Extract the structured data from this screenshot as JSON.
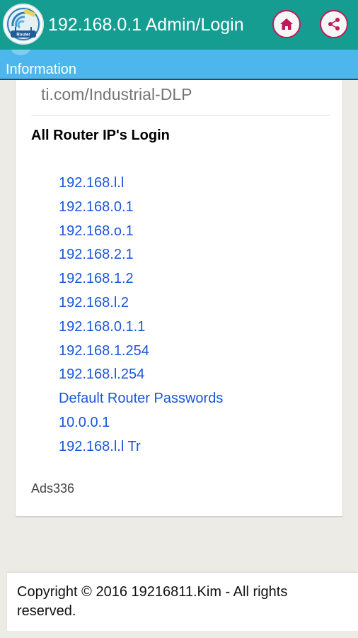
{
  "appbar": {
    "title": "192.168.0.1 Admin/Login",
    "logo_icon": "router-logo-icon",
    "logo_text": "Router",
    "home_icon": "home-icon",
    "share_icon": "share-icon"
  },
  "info_strip": {
    "label": "Information"
  },
  "card": {
    "url_text": "ti.com/Industrial-DLP",
    "section_title": "All Router IP's Login",
    "links": [
      "192.168.l.l",
      "192.168.0.1",
      "192.168.o.1",
      "192.168.2.1",
      "192.168.1.2",
      "192.168.l.2",
      "192.168.0.1.1",
      "192.168.1.254",
      "192.168.l.254",
      "Default Router Passwords",
      "10.0.0.1",
      "192.168.l.l Tr"
    ],
    "ads_label": "Ads336"
  },
  "footer": {
    "copyright": "Copyright © 2016 19216811.Kim - All rights reserved."
  },
  "colors": {
    "appbar": "#169d92",
    "strip": "#4db6ec",
    "link": "#1a56db",
    "icon_accent": "#c2185b",
    "background": "#edebe5"
  }
}
